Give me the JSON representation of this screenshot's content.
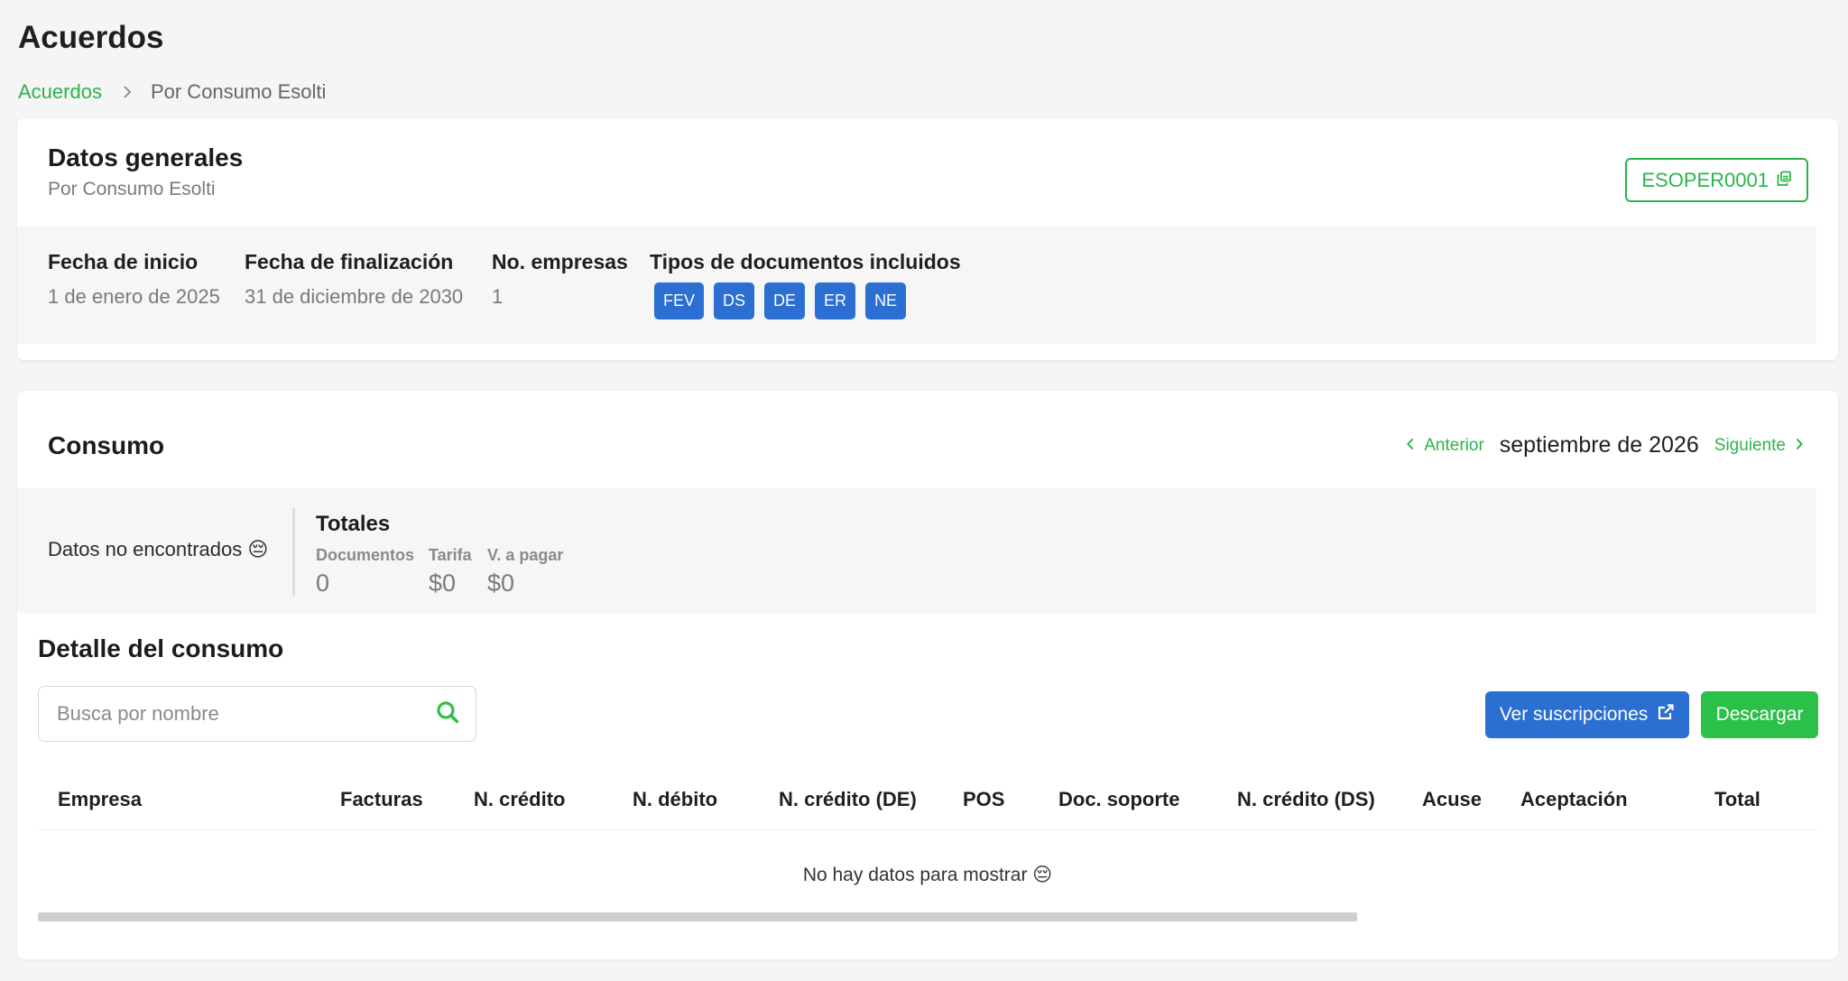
{
  "page": {
    "title": "Acuerdos"
  },
  "breadcrumb": {
    "root": "Acuerdos",
    "current": "Por Consumo Esolti"
  },
  "general": {
    "title": "Datos generales",
    "subtitle": "Por Consumo Esolti",
    "code": "ESOPER0001",
    "fields": {
      "start": {
        "label": "Fecha de inicio",
        "value": "1 de enero de 2025"
      },
      "end": {
        "label": "Fecha de finalización",
        "value": "31 de diciembre de 2030"
      },
      "companies": {
        "label": "No. empresas",
        "value": "1"
      },
      "doc_types": {
        "label": "Tipos de documentos incluidos"
      }
    },
    "doc_types": [
      "FEV",
      "DS",
      "DE",
      "ER",
      "NE"
    ]
  },
  "consumo": {
    "title": "Consumo",
    "prev_label": "Anterior",
    "month": "septiembre de 2026",
    "next_label": "Siguiente",
    "no_data": "Datos no encontrados 😔",
    "totals": {
      "title": "Totales",
      "documents": {
        "label": "Documentos",
        "value": "0"
      },
      "rate": {
        "label": "Tarifa",
        "value": "$0"
      },
      "to_pay": {
        "label": "V. a pagar",
        "value": "$0"
      }
    }
  },
  "detail": {
    "title": "Detalle del consumo",
    "search_placeholder": "Busca por nombre",
    "subscriptions_label": "Ver suscripciones",
    "download_label": "Descargar",
    "columns": [
      "Empresa",
      "Facturas",
      "N. crédito",
      "N. débito",
      "N. crédito (DE)",
      "POS",
      "Doc. soporte",
      "N. crédito (DS)",
      "Acuse",
      "Aceptación",
      "Total"
    ],
    "empty_message": "No hay datos para mostrar 😔"
  },
  "colors": {
    "green": "#2bb44a",
    "blue": "#2a6fd1"
  },
  "icons": [
    "chevron-right-icon",
    "copy-icon",
    "chevron-left-icon",
    "search-icon",
    "external-link-icon"
  ]
}
